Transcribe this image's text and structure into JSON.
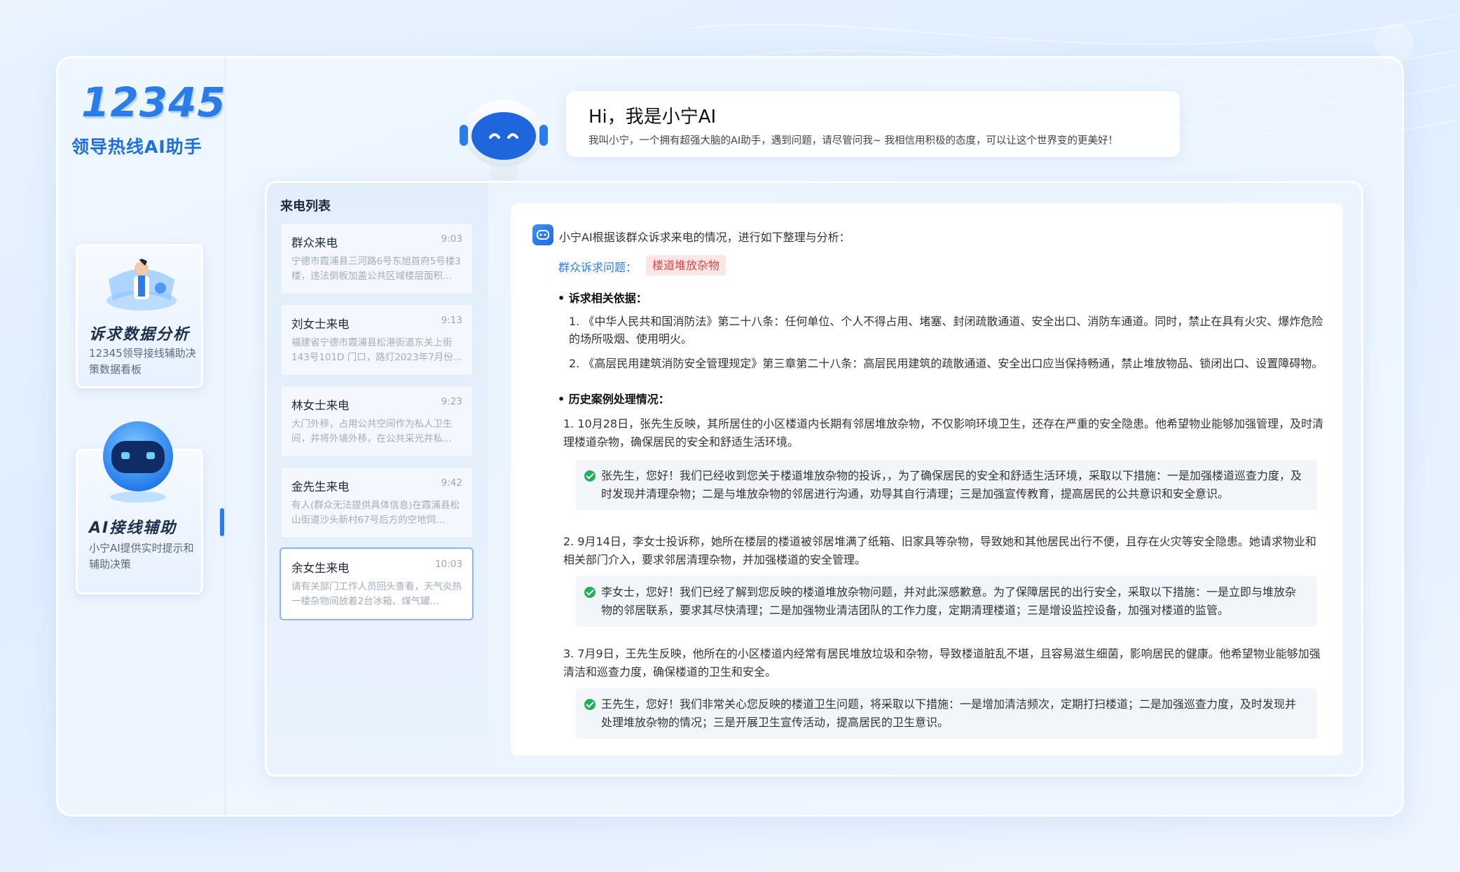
{
  "brand": {
    "number": "12345",
    "subtitle": "领导热线AI助手"
  },
  "nav": [
    {
      "title": "诉求数据分析",
      "desc": "12345领导接线辅助决策数据看板"
    },
    {
      "title": "AI接线辅助",
      "desc": "小宁AI提供实时提示和辅助决策"
    }
  ],
  "greeting": {
    "title": "Hi，我是小宁AI",
    "desc": "我叫小宁，一个拥有超强大脑的AI助手，遇到问题，请尽管问我~ 我相信用积极的态度，可以让这个世界变的更美好！"
  },
  "call_list": {
    "title": "来电列表",
    "items": [
      {
        "name": "群众来电",
        "time": "9:03",
        "snippet": "宁德市霞浦县三河路6号东旭首府5号楼3楼，违法倒板加盖公共区域楼层面积..."
      },
      {
        "name": "刘女士来电",
        "time": "9:13",
        "snippet": "福建省宁德市霞浦县松港街道东关上街143号101D 门口，路灯2023年7月份..."
      },
      {
        "name": "林女士来电",
        "time": "9:23",
        "snippet": "大门外移，占用公共空间作为私人卫生间，并将外墙外移，在公共采光井私..."
      },
      {
        "name": "金先生来电",
        "time": "9:42",
        "snippet": "有人(群众无法提供具体信息)在霞浦县松山街道沙头新村67号后方的空地饲..."
      },
      {
        "name": "余女生来电",
        "time": "10:03",
        "snippet": "请有关部门工作人员回头查看，天气炎热一楼杂物间放着2台冰箱、煤气罐..."
      }
    ]
  },
  "analysis": {
    "intro": "小宁AI根据该群众诉求来电的情况，进行如下整理与分析：",
    "issue_label": "群众诉求问题：",
    "issue_tag": "楼道堆放杂物",
    "basis_title": "• 诉求相关依据：",
    "basis": [
      "1. 《中华人民共和国消防法》第二十八条：任何单位、个人不得占用、堵塞、封闭疏散通道、安全出口、消防车通道。同时，禁止在具有火灾、爆炸危险的场所吸烟、使用明火。",
      "2. 《高层民用建筑消防安全管理规定》第三章第二十八条：高层民用建筑的疏散通道、安全出口应当保持畅通，禁止堆放物品、锁闭出口、设置障碍物。"
    ],
    "history_title": "• 历史案例处理情况：",
    "cases": [
      {
        "text": "1. 10月28日，张先生反映，其所居住的小区楼道内长期有邻居堆放杂物，不仅影响环境卫生，还存在严重的安全隐患。他希望物业能够加强管理，及时清理楼道杂物，确保居民的安全和舒适生活环境。",
        "reply": "张先生，您好！我们已经收到您关于楼道堆放杂物的投诉，，为了确保居民的安全和舒适生活环境，采取以下措施：一是加强楼道巡查力度，及时发现并清理杂物；二是与堆放杂物的邻居进行沟通，劝导其自行清理；三是加强宣传教育，提高居民的公共意识和安全意识。"
      },
      {
        "text": "2. 9月14日，李女士投诉称，她所在楼层的楼道被邻居堆满了纸箱、旧家具等杂物，导致她和其他居民出行不便，且存在火灾等安全隐患。她请求物业和相关部门介入，要求邻居清理杂物，并加强楼道的安全管理。",
        "reply": "李女士，您好！我们已经了解到您反映的楼道堆放杂物问题，并对此深感歉意。为了保障居民的出行安全，采取以下措施：一是立即与堆放杂物的邻居联系，要求其尽快清理；二是加强物业清洁团队的工作力度，定期清理楼道；三是增设监控设备，加强对楼道的监管。"
      },
      {
        "text": "3. 7月9日，王先生反映，他所在的小区楼道内经常有居民堆放垃圾和杂物，导致楼道脏乱不堪，且容易滋生细菌，影响居民的健康。他希望物业能够加强清洁和巡查力度，确保楼道的卫生和安全。",
        "reply": "王先生，您好！我们非常关心您反映的楼道卫生问题，将采取以下措施：一是增加清洁频次，定期打扫楼道；二是加强巡查力度，及时发现并处理堆放杂物的情况；三是开展卫生宣传活动，提高居民的卫生意识。"
      }
    ]
  },
  "colors": {
    "accent": "#2a7de8",
    "tag_bg": "#fde6e6",
    "tag_text": "#e04848",
    "check": "#22b05a"
  }
}
